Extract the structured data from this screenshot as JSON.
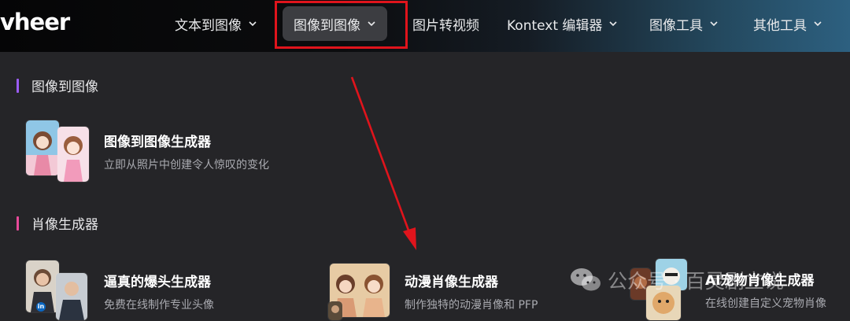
{
  "nav": {
    "logo": "vheer",
    "items": [
      {
        "label": "文本到图像",
        "has_dropdown": true
      },
      {
        "label": "图像到图像",
        "has_dropdown": true,
        "active": true
      },
      {
        "label": "图片转视频",
        "has_dropdown": false
      },
      {
        "label": "Kontext 编辑器",
        "has_dropdown": true
      },
      {
        "label": "图像工具",
        "has_dropdown": true
      },
      {
        "label": "其他工具",
        "has_dropdown": true
      }
    ]
  },
  "sections": [
    {
      "title": "图像到图像",
      "accent": "#9b5cf6",
      "cards": [
        {
          "title": "图像到图像生成器",
          "desc": "立即从照片中创建令人惊叹的变化"
        }
      ]
    },
    {
      "title": "肖像生成器",
      "accent": "#e84a9a",
      "cards": [
        {
          "title": "逼真的爆头生成器",
          "desc": "免费在线制作专业头像"
        },
        {
          "title": "动漫肖像生成器",
          "desc": "制作独特的动漫肖像和 PFP"
        },
        {
          "title": "AI宠物肖像生成器",
          "desc": "在线创建自定义宠物肖像"
        }
      ]
    }
  ],
  "watermark": {
    "text": "公众号 · 百灵剧立说",
    "icon": "wechat-icon"
  },
  "colors": {
    "highlight": "#e0141c",
    "arrow": "#e0141c",
    "background": "#252528"
  }
}
